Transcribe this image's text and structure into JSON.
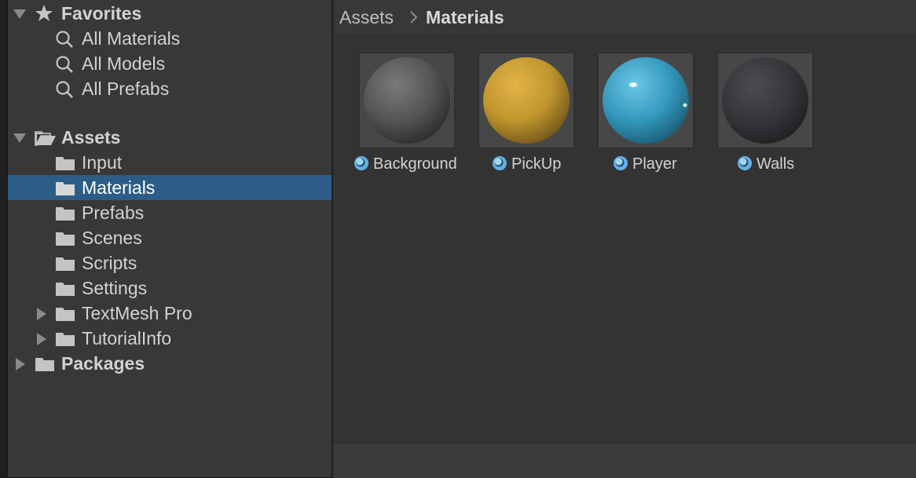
{
  "breadcrumb": {
    "root": "Assets",
    "current": "Materials"
  },
  "sidebar": {
    "favorites": {
      "label": "Favorites",
      "items": [
        {
          "label": "All Materials",
          "icon": "search-icon"
        },
        {
          "label": "All Models",
          "icon": "search-icon"
        },
        {
          "label": "All Prefabs",
          "icon": "search-icon"
        }
      ]
    },
    "assets": {
      "label": "Assets",
      "items": [
        {
          "label": "Input",
          "icon": "folder-icon"
        },
        {
          "label": "Materials",
          "icon": "folder-icon",
          "selected": true
        },
        {
          "label": "Prefabs",
          "icon": "folder-icon"
        },
        {
          "label": "Scenes",
          "icon": "folder-icon"
        },
        {
          "label": "Scripts",
          "icon": "folder-icon"
        },
        {
          "label": "Settings",
          "icon": "folder-icon"
        },
        {
          "label": "TextMesh Pro",
          "icon": "folder-icon",
          "expandable": true
        },
        {
          "label": "TutorialInfo",
          "icon": "folder-icon",
          "expandable": true
        }
      ]
    },
    "packages": {
      "label": "Packages",
      "icon": "folder-icon",
      "expandable": true
    }
  },
  "materials": [
    {
      "name": "Background",
      "color": "#5a5a5a"
    },
    {
      "name": "PickUp",
      "color": "#c89a2e"
    },
    {
      "name": "Player",
      "color": "#36a2c8"
    },
    {
      "name": "Walls",
      "color": "#3a3b3d"
    }
  ],
  "colors": {
    "selection": "#2c5d87",
    "material_icon": "#5fb3ea"
  }
}
